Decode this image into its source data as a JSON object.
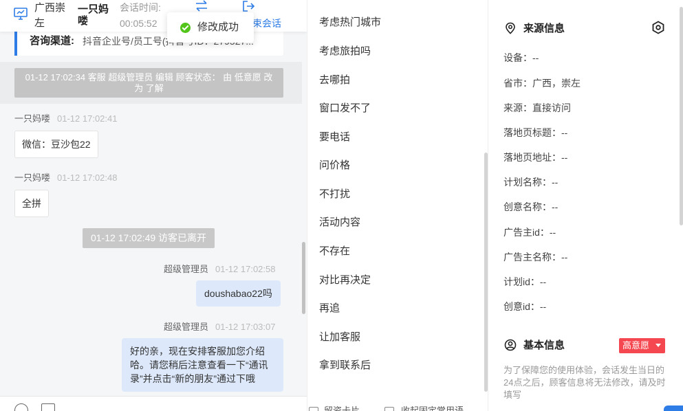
{
  "chat_header": {
    "region": "广西崇左",
    "customer_name": "一只妈喽",
    "session_time_label": "会话时间:",
    "session_time_value": "00:05:52",
    "end_session_label": "束会话"
  },
  "toast": {
    "text": "修改成功"
  },
  "channel": {
    "label": "咨询渠道:",
    "value": "抖音企业号/员工号(抖音号ID：279527..."
  },
  "messages": {
    "system_status": "01-12 17:02:34 客服 超级管理员 编辑 顾客状态： 由 低意愿 改为 了解",
    "msg1_sender": "一只妈喽",
    "msg1_time": "01-12 17:02:41",
    "msg1_text": "微信：豆沙包22",
    "msg2_sender": "一只妈喽",
    "msg2_time": "01-12 17:02:48",
    "msg2_text": "全拼",
    "system_left": "01-12 17:02:49 访客已离开",
    "msg3_sender": "超级管理员",
    "msg3_time": "01-12 17:02:58",
    "msg3_text": "doushabao22吗",
    "msg4_sender": "超级管理员",
    "msg4_time": "01-12 17:03:07",
    "msg4_text": "好的亲，现在安排客服加您介绍哈。请您稍后注意查看一下“通讯录”并点击“新的朋友”通过下哦"
  },
  "quick_tags": [
    "考虑热门城市",
    "考虑旅拍吗",
    "去哪拍",
    "窗口发不了",
    "要电话",
    "问价格",
    "不打扰",
    "活动内容",
    "不存在",
    "对比再决定",
    "再追",
    "让加客服",
    "拿到联系后"
  ],
  "quick_footer": {
    "option1": "留资卡片",
    "option2": "收起固定常用语"
  },
  "source_info": {
    "title": "来源信息",
    "device": "设备：--",
    "province": "省市：广西，崇左",
    "source": "来源：直接访问",
    "landing_title": "落地页标题：--",
    "landing_url": "落地页地址：--",
    "plan_name": "计划名称：--",
    "creative_name": "创意名称：--",
    "advertiser_id": "广告主id：--",
    "advertiser_name": "广告主名称：--",
    "plan_id": "计划id：--",
    "creative_id": "创意id：--"
  },
  "basic_info": {
    "title": "基本信息",
    "intent_badge": "高意愿",
    "notice": "为了保障您的使用体验，会话发生当日的24点之后，顾客信息将无法修改，请及时填写"
  },
  "colors": {
    "accent": "#2e7ce6",
    "success": "#52c41a",
    "danger": "#f5474f",
    "outgoing_bubble": "#dde9fb"
  },
  "icons": [
    "monitor-icon",
    "transfer-icon",
    "exit-icon",
    "check-circle-icon",
    "emoji-icon",
    "image-icon",
    "location-pin-icon",
    "settings-icon",
    "user-circle-icon",
    "caret-down-icon"
  ]
}
